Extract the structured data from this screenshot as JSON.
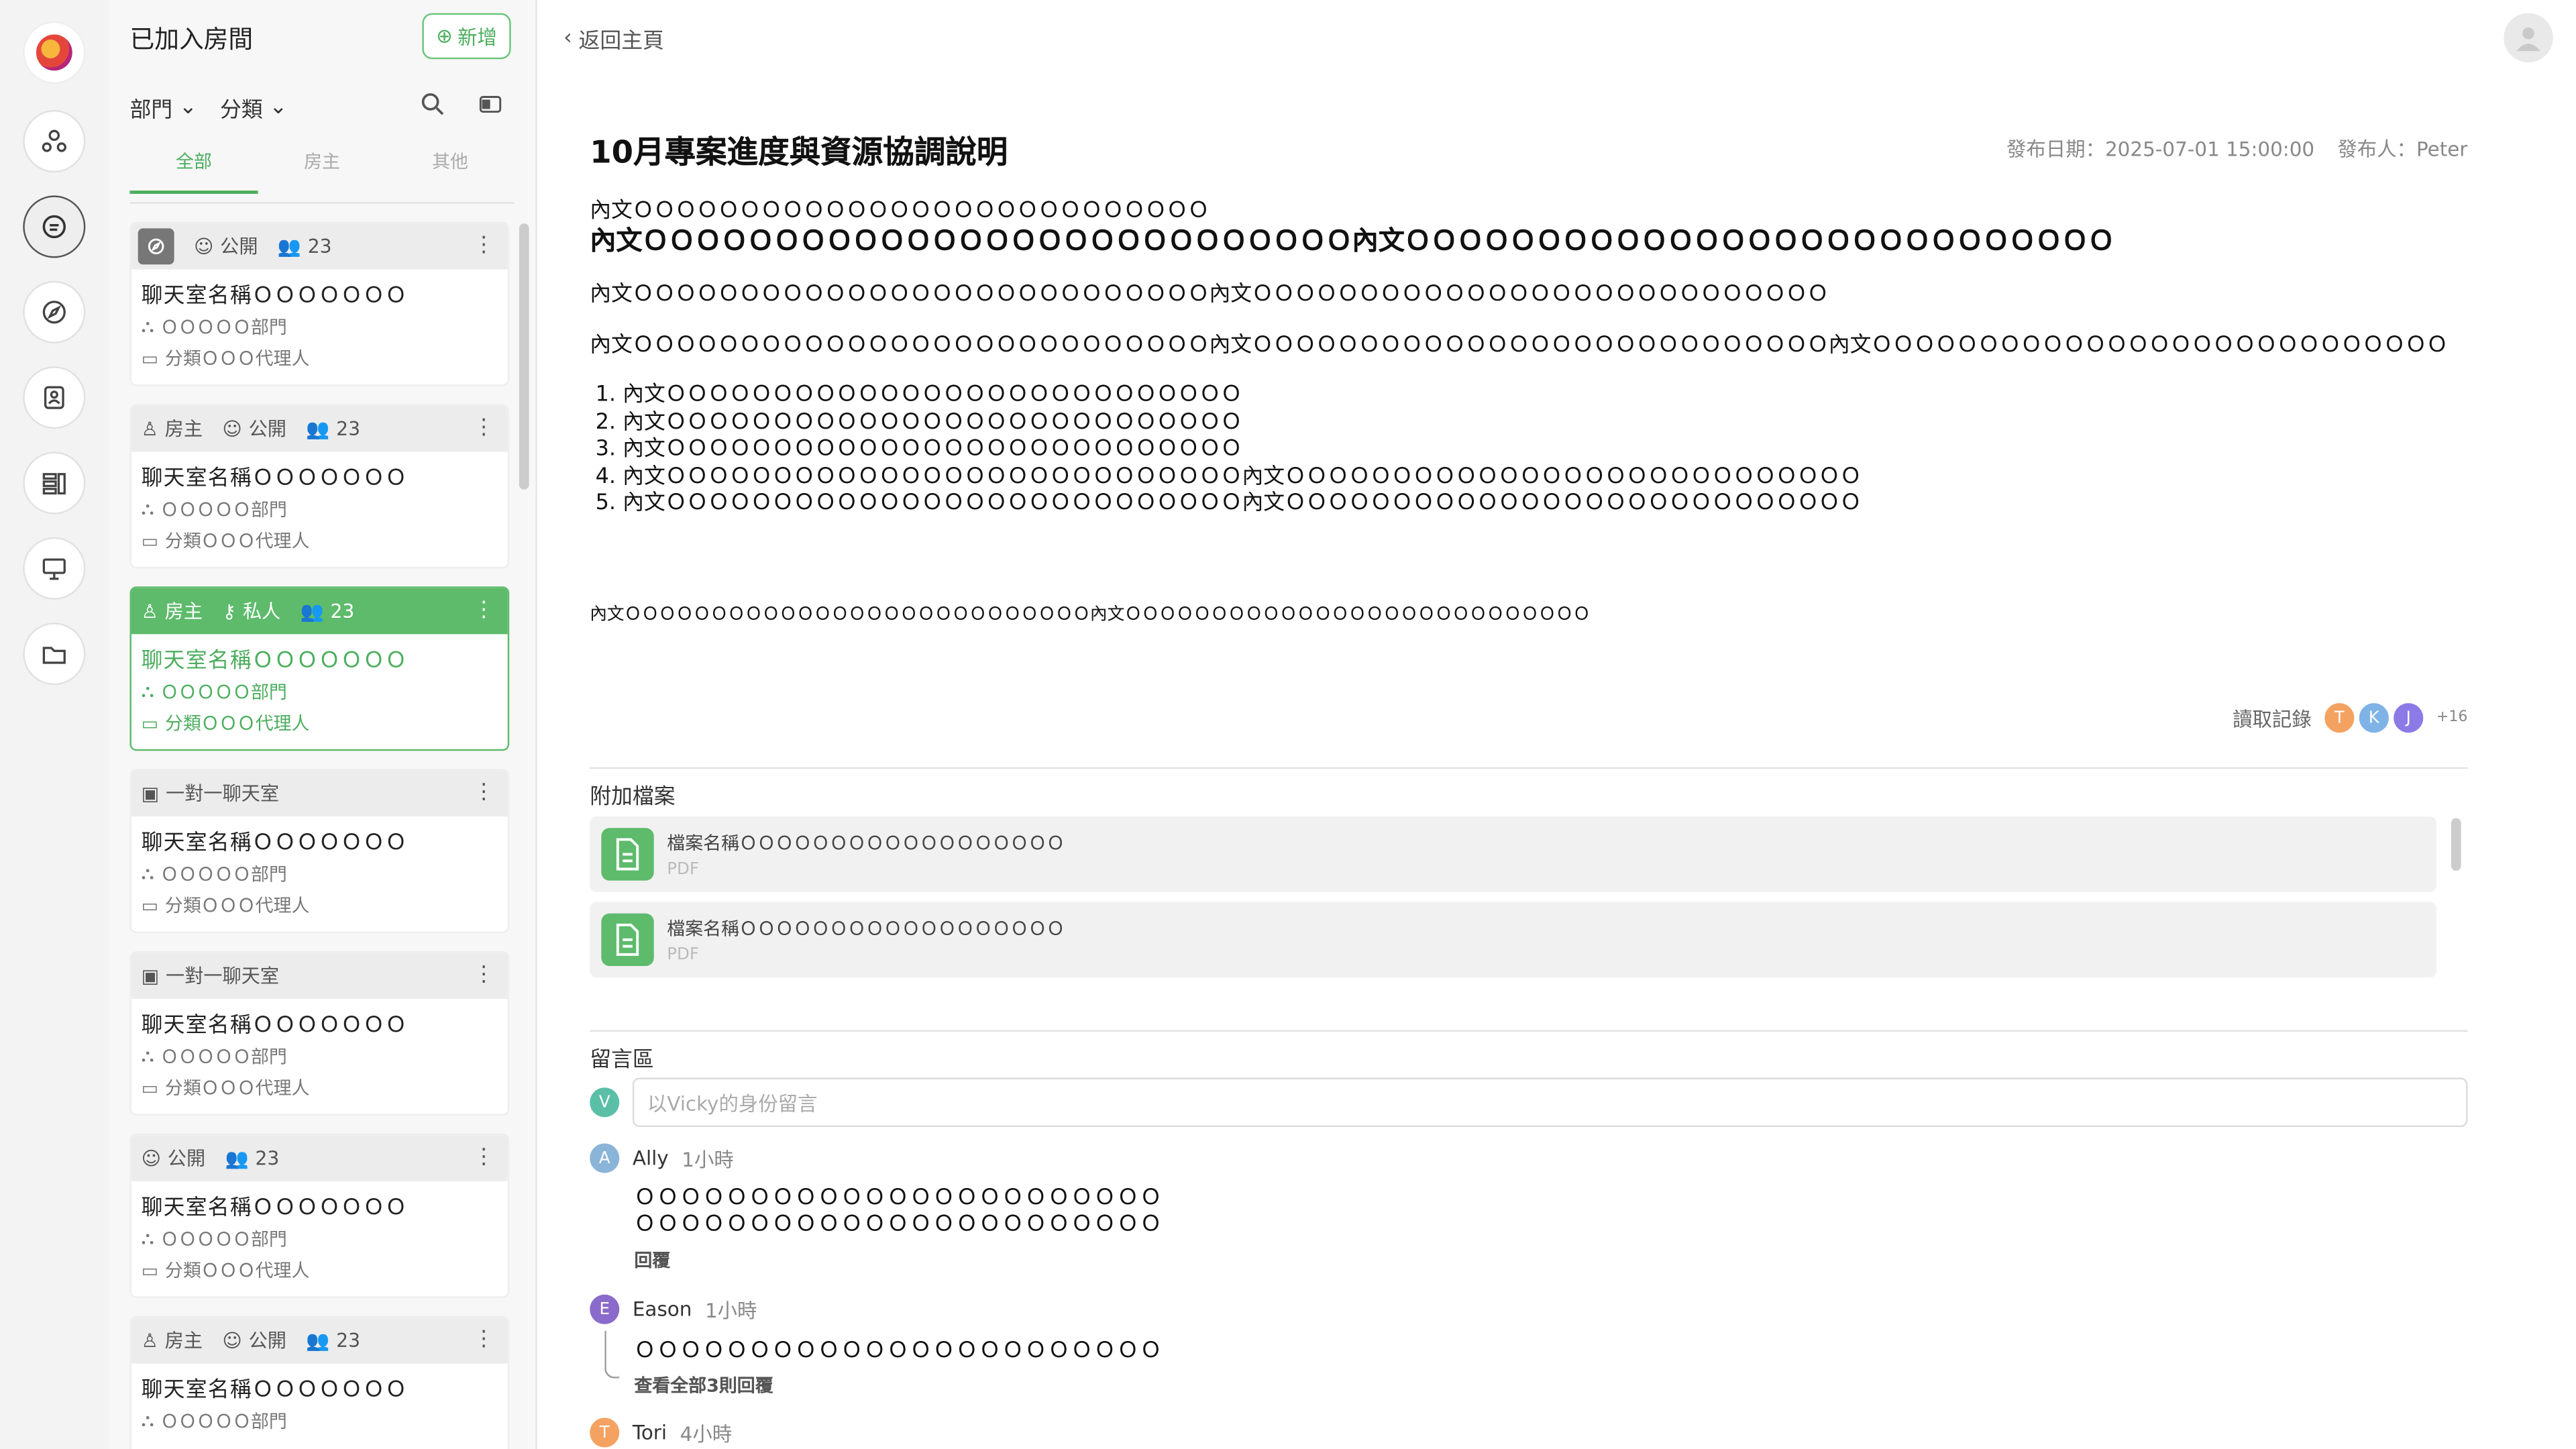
{
  "panel": {
    "title": "已加入房間",
    "add_label": "新增",
    "filters": [
      "部門",
      "分類"
    ],
    "tabs": [
      "全部",
      "房主",
      "其他"
    ]
  },
  "rooms": [
    {
      "tags": [
        "公開",
        "23"
      ],
      "name": "聊天室名稱ＯＯＯＯＯＯＯ",
      "dept": "ＯＯＯＯＯ部門",
      "category": "分類ＯＯＯ代理人"
    },
    {
      "tags": [
        "房主",
        "公開",
        "23"
      ],
      "name": "聊天室名稱ＯＯＯＯＯＯＯ",
      "dept": "ＯＯＯＯＯ部門",
      "category": "分類ＯＯＯ代理人"
    },
    {
      "tags": [
        "房主",
        "私人",
        "23"
      ],
      "name": "聊天室名稱ＯＯＯＯＯＯＯ",
      "dept": "ＯＯＯＯＯ部門",
      "category": "分類ＯＯＯ代理人"
    },
    {
      "tags": [
        "一對一聊天室"
      ],
      "name": "聊天室名稱ＯＯＯＯＯＯＯ",
      "dept": "ＯＯＯＯＯ部門",
      "category": "分類ＯＯＯ代理人"
    },
    {
      "tags": [
        "一對一聊天室"
      ],
      "name": "聊天室名稱ＯＯＯＯＯＯＯ",
      "dept": "ＯＯＯＯＯ部門",
      "category": "分類ＯＯＯ代理人"
    },
    {
      "tags": [
        "公開",
        "23"
      ],
      "name": "聊天室名稱ＯＯＯＯＯＯＯ",
      "dept": "ＯＯＯＯＯ部門",
      "category": "分類ＯＯＯ代理人"
    },
    {
      "tags": [
        "房主",
        "公開",
        "23"
      ],
      "name": "聊天室名稱ＯＯＯＯＯＯＯ",
      "dept": "ＯＯＯＯＯ部門",
      "category": ""
    }
  ],
  "main": {
    "back_label": "返回主頁",
    "title": "10月專案進度與資源協調說明",
    "publish_date": "發布日期：2025-07-01 15:00:00",
    "publisher": "發布人：Peter",
    "content": {
      "line1": "內文ＯＯＯＯＯＯＯＯＯＯＯＯＯＯＯＯＯＯＯＯＯＯＯＯＯＯＯ",
      "line2": "內文ＯＯＯＯＯＯＯＯＯＯＯＯＯＯＯＯＯＯＯＯＯＯＯＯＯＯＯ內文ＯＯＯＯＯＯＯＯＯＯＯＯＯＯＯＯＯＯＯＯＯＯＯＯＯＯＯ",
      "line3": "內文ＯＯＯＯＯＯＯＯＯＯＯＯＯＯＯＯＯＯＯＯＯＯＯＯＯＯＯ內文ＯＯＯＯＯＯＯＯＯＯＯＯＯＯＯＯＯＯＯＯＯＯＯＯＯＯＯ",
      "line4": "內文ＯＯＯＯＯＯＯＯＯＯＯＯＯＯＯＯＯＯＯＯＯＯＯＯＯＯＯ內文ＯＯＯＯＯＯＯＯＯＯＯＯＯＯＯＯＯＯＯＯＯＯＯＯＯＯＯ內文ＯＯＯＯＯＯＯＯＯＯＯＯＯＯＯＯＯＯＯＯＯＯＯＯＯＯＯ",
      "list": [
        "內文ＯＯＯＯＯＯＯＯＯＯＯＯＯＯＯＯＯＯＯＯＯＯＯＯＯＯＯ",
        "內文ＯＯＯＯＯＯＯＯＯＯＯＯＯＯＯＯＯＯＯＯＯＯＯＯＯＯＯ",
        "內文ＯＯＯＯＯＯＯＯＯＯＯＯＯＯＯＯＯＯＯＯＯＯＯＯＯＯＯ",
        "內文ＯＯＯＯＯＯＯＯＯＯＯＯＯＯＯＯＯＯＯＯＯＯＯＯＯＯＯ內文ＯＯＯＯＯＯＯＯＯＯＯＯＯＯＯＯＯＯＯＯＯＯＯＯＯＯＯ",
        "內文ＯＯＯＯＯＯＯＯＯＯＯＯＯＯＯＯＯＯＯＯＯＯＯＯＯＯＯ內文ＯＯＯＯＯＯＯＯＯＯＯＯＯＯＯＯＯＯＯＯＯＯＯＯＯＯＯ"
      ],
      "small_line": "內文ＯＯＯＯＯＯＯＯＯＯＯＯＯＯＯＯＯＯＯＯＯＯＯＯＯＯＯ內文ＯＯＯＯＯＯＯＯＯＯＯＯＯＯＯＯＯＯＯＯＯＯＯＯＯＯＯ"
    },
    "read_record": {
      "label": "讀取記錄",
      "avatars": [
        "T",
        "K",
        "J"
      ],
      "more": "+16"
    },
    "attachments": {
      "title": "附加檔案",
      "files": [
        {
          "name": "檔案名稱ＯＯＯＯＯＯＯＯＯＯＯＯＯＯＯＯＯＯ",
          "type": "PDF"
        },
        {
          "name": "檔案名稱ＯＯＯＯＯＯＯＯＯＯＯＯＯＯＯＯＯＯ",
          "type": "PDF"
        }
      ]
    },
    "comments": {
      "title": "留言區",
      "input_avatar": "V",
      "placeholder": "以Vicky的身份留言",
      "items": [
        {
          "avatar": "A",
          "author": "Ally",
          "time": "1小時",
          "lines": [
            "ＯＯＯＯＯＯＯＯＯＯＯＯＯＯＯＯＯＯＯＯＯＯＯ",
            "ＯＯＯＯＯＯＯＯＯＯＯＯＯＯＯＯＯＯＯＯＯＯＯ"
          ],
          "reply": "回覆"
        },
        {
          "avatar": "E",
          "author": "Eason",
          "time": "1小時",
          "lines": [
            "ＯＯＯＯＯＯＯＯＯＯＯＯＯＯＯＯＯＯＯＯＯＯＯ"
          ],
          "reply": "查看全部3則回覆"
        },
        {
          "avatar": "T",
          "author": "Tori",
          "time": "4小時",
          "lines": []
        }
      ]
    }
  },
  "colors": {
    "accent": "#5dbb6b",
    "avatar_T": "#f4a261",
    "avatar_K": "#7fb3e6",
    "avatar_J": "#8c7ae6",
    "avatar_V": "#5bbfa8",
    "avatar_A": "#8ab4d8",
    "avatar_E": "#8a6bcb"
  }
}
